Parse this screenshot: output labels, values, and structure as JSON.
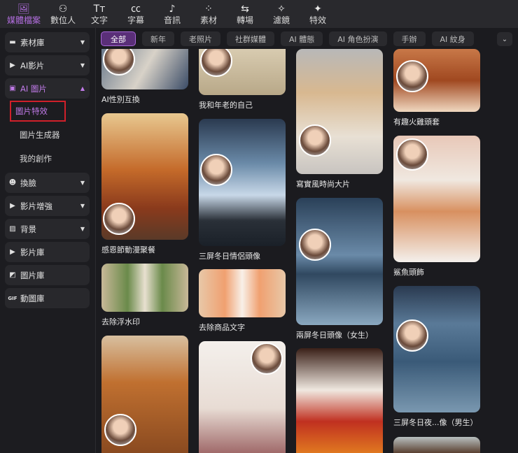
{
  "toolbar": [
    {
      "label": "媒體檔案",
      "icon": "media-icon",
      "glyph": "🖼"
    },
    {
      "label": "數位人",
      "icon": "avatar-person-icon",
      "glyph": "⚇"
    },
    {
      "label": "文字",
      "icon": "text-icon",
      "glyph": "Tт"
    },
    {
      "label": "字幕",
      "icon": "caption-icon",
      "glyph": "㏄"
    },
    {
      "label": "音訊",
      "icon": "music-note-icon",
      "glyph": "♪"
    },
    {
      "label": "素材",
      "icon": "elements-icon",
      "glyph": "⁘"
    },
    {
      "label": "轉場",
      "icon": "transition-icon",
      "glyph": "⇆"
    },
    {
      "label": "濾鏡",
      "icon": "filter-sparkle-icon",
      "glyph": "✧"
    },
    {
      "label": "特效",
      "icon": "effects-icon",
      "glyph": "✦"
    }
  ],
  "sidebar": {
    "items": [
      {
        "label": "素材庫",
        "icon": "folder-icon",
        "glyph": "▬"
      },
      {
        "label": "AI影片",
        "icon": "ai-video-icon",
        "glyph": "▶"
      },
      {
        "label": "AI 圖片",
        "icon": "ai-image-icon",
        "glyph": "▣"
      },
      {
        "label": "換臉",
        "icon": "face-swap-icon",
        "glyph": "☻"
      },
      {
        "label": "影片增強",
        "icon": "video-enhance-icon",
        "glyph": "▶"
      },
      {
        "label": "背景",
        "icon": "background-icon",
        "glyph": "▨"
      },
      {
        "label": "影片庫",
        "icon": "video-library-icon",
        "glyph": "▶"
      },
      {
        "label": "圖片庫",
        "icon": "image-library-icon",
        "glyph": "◩"
      },
      {
        "label": "動圖庫",
        "icon": "gif-library-icon",
        "glyph": "GIF"
      }
    ],
    "sub_items": [
      "圖片特效",
      "圖片生成器",
      "我的創作"
    ]
  },
  "filters": [
    "全部",
    "新年",
    "老照片",
    "社群媒體",
    "AI 體態",
    "AI 角色扮演",
    "手辦",
    "AI 紋身"
  ],
  "cards": [
    {
      "caption": "AI性別互換",
      "bg": "linear-gradient(120deg,#6b7a8c,#d8d2c8 50%,#3a4b66)"
    },
    {
      "caption": "感恩節動漫聚餐",
      "bg": "linear-gradient(180deg,#e8c890,#c46a2a 45%,#8a3a1c 75%,#5a3a28)"
    },
    {
      "caption": "去除浮水印",
      "bg": "linear-gradient(90deg,#c8b898,#6a8a4a 30%,#e8e0d0 50%,#6a8a4a 70%,#c8b898)"
    },
    {
      "caption": "",
      "bg": "linear-gradient(180deg,#d8c0a0,#c07030 40%,#8a4a20)"
    },
    {
      "caption": "我和年老的自己",
      "bg": "linear-gradient(180deg,#d8cbb0,#b8a888)"
    },
    {
      "caption": "三屏冬日情侶頭像",
      "bg": "linear-gradient(180deg,#2a3a50,#6a8aa8 35%,#c8d8e8 60%,#2a3038 80%,#1a2028)"
    },
    {
      "caption": "去除商品文字",
      "bg": "linear-gradient(90deg,#e8c8a8,#f0a070 30%,#f8f0e8 50%,#f0a070 70%,#e8c8a8)"
    },
    {
      "caption": "",
      "bg": "linear-gradient(180deg,#f4f0ec,#e8dcd4 60%,#a06a6a)"
    },
    {
      "caption": "寫實風時尚大片",
      "bg": "linear-gradient(180deg,#b8b8b8,#d8b890 35%,#e8e0d4 70%,#c8c4c0)"
    },
    {
      "caption": "兩屏冬日頭像（女生）",
      "bg": "linear-gradient(180deg,#2a4058,#6a8aa8 45%,#304860 60%,#8aa8c0)"
    },
    {
      "caption": "",
      "bg": "linear-gradient(180deg,#3a2018,#f0e8e0 40%,#c03020 70%,#e07820)"
    },
    {
      "caption": "有趣火雞頭套",
      "bg": "linear-gradient(180deg,#c87848,#a04820 50%,#f0d8c0)"
    },
    {
      "caption": "鯊魚頭飾",
      "bg": "linear-gradient(180deg,#e8c8b8,#f0e8e0 35%,#d89060 60%,#f4f0ec)"
    },
    {
      "caption": "三屏冬日夜...像（男生）",
      "bg": "linear-gradient(180deg,#2a3a50,#5a7a98 30%,#3a5a78 60%,#7a98b0)"
    },
    {
      "caption": "",
      "bg": "linear-gradient(180deg,#b8c0c0,#5a4030)"
    }
  ]
}
